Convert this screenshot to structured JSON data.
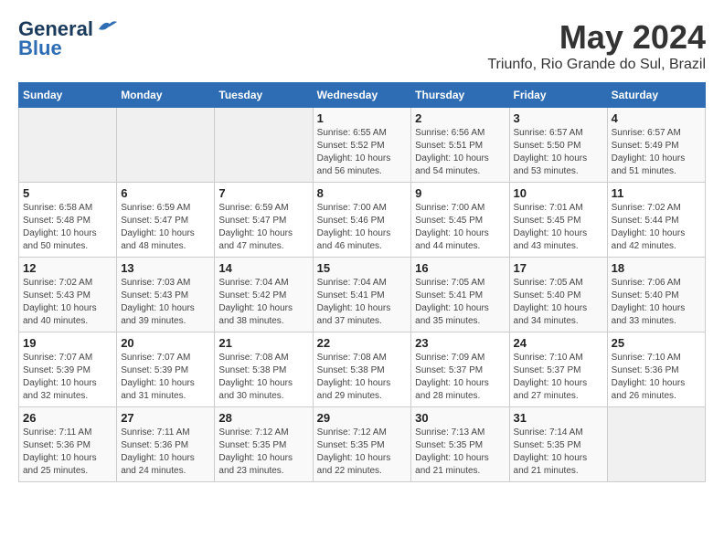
{
  "header": {
    "logo_line1": "General",
    "logo_line2": "Blue",
    "month_year": "May 2024",
    "location": "Triunfo, Rio Grande do Sul, Brazil"
  },
  "days_of_week": [
    "Sunday",
    "Monday",
    "Tuesday",
    "Wednesday",
    "Thursday",
    "Friday",
    "Saturday"
  ],
  "weeks": [
    [
      {
        "day": "",
        "sunrise": "",
        "sunset": "",
        "daylight": ""
      },
      {
        "day": "",
        "sunrise": "",
        "sunset": "",
        "daylight": ""
      },
      {
        "day": "",
        "sunrise": "",
        "sunset": "",
        "daylight": ""
      },
      {
        "day": "1",
        "sunrise": "Sunrise: 6:55 AM",
        "sunset": "Sunset: 5:52 PM",
        "daylight": "Daylight: 10 hours and 56 minutes."
      },
      {
        "day": "2",
        "sunrise": "Sunrise: 6:56 AM",
        "sunset": "Sunset: 5:51 PM",
        "daylight": "Daylight: 10 hours and 54 minutes."
      },
      {
        "day": "3",
        "sunrise": "Sunrise: 6:57 AM",
        "sunset": "Sunset: 5:50 PM",
        "daylight": "Daylight: 10 hours and 53 minutes."
      },
      {
        "day": "4",
        "sunrise": "Sunrise: 6:57 AM",
        "sunset": "Sunset: 5:49 PM",
        "daylight": "Daylight: 10 hours and 51 minutes."
      }
    ],
    [
      {
        "day": "5",
        "sunrise": "Sunrise: 6:58 AM",
        "sunset": "Sunset: 5:48 PM",
        "daylight": "Daylight: 10 hours and 50 minutes."
      },
      {
        "day": "6",
        "sunrise": "Sunrise: 6:59 AM",
        "sunset": "Sunset: 5:47 PM",
        "daylight": "Daylight: 10 hours and 48 minutes."
      },
      {
        "day": "7",
        "sunrise": "Sunrise: 6:59 AM",
        "sunset": "Sunset: 5:47 PM",
        "daylight": "Daylight: 10 hours and 47 minutes."
      },
      {
        "day": "8",
        "sunrise": "Sunrise: 7:00 AM",
        "sunset": "Sunset: 5:46 PM",
        "daylight": "Daylight: 10 hours and 46 minutes."
      },
      {
        "day": "9",
        "sunrise": "Sunrise: 7:00 AM",
        "sunset": "Sunset: 5:45 PM",
        "daylight": "Daylight: 10 hours and 44 minutes."
      },
      {
        "day": "10",
        "sunrise": "Sunrise: 7:01 AM",
        "sunset": "Sunset: 5:45 PM",
        "daylight": "Daylight: 10 hours and 43 minutes."
      },
      {
        "day": "11",
        "sunrise": "Sunrise: 7:02 AM",
        "sunset": "Sunset: 5:44 PM",
        "daylight": "Daylight: 10 hours and 42 minutes."
      }
    ],
    [
      {
        "day": "12",
        "sunrise": "Sunrise: 7:02 AM",
        "sunset": "Sunset: 5:43 PM",
        "daylight": "Daylight: 10 hours and 40 minutes."
      },
      {
        "day": "13",
        "sunrise": "Sunrise: 7:03 AM",
        "sunset": "Sunset: 5:43 PM",
        "daylight": "Daylight: 10 hours and 39 minutes."
      },
      {
        "day": "14",
        "sunrise": "Sunrise: 7:04 AM",
        "sunset": "Sunset: 5:42 PM",
        "daylight": "Daylight: 10 hours and 38 minutes."
      },
      {
        "day": "15",
        "sunrise": "Sunrise: 7:04 AM",
        "sunset": "Sunset: 5:41 PM",
        "daylight": "Daylight: 10 hours and 37 minutes."
      },
      {
        "day": "16",
        "sunrise": "Sunrise: 7:05 AM",
        "sunset": "Sunset: 5:41 PM",
        "daylight": "Daylight: 10 hours and 35 minutes."
      },
      {
        "day": "17",
        "sunrise": "Sunrise: 7:05 AM",
        "sunset": "Sunset: 5:40 PM",
        "daylight": "Daylight: 10 hours and 34 minutes."
      },
      {
        "day": "18",
        "sunrise": "Sunrise: 7:06 AM",
        "sunset": "Sunset: 5:40 PM",
        "daylight": "Daylight: 10 hours and 33 minutes."
      }
    ],
    [
      {
        "day": "19",
        "sunrise": "Sunrise: 7:07 AM",
        "sunset": "Sunset: 5:39 PM",
        "daylight": "Daylight: 10 hours and 32 minutes."
      },
      {
        "day": "20",
        "sunrise": "Sunrise: 7:07 AM",
        "sunset": "Sunset: 5:39 PM",
        "daylight": "Daylight: 10 hours and 31 minutes."
      },
      {
        "day": "21",
        "sunrise": "Sunrise: 7:08 AM",
        "sunset": "Sunset: 5:38 PM",
        "daylight": "Daylight: 10 hours and 30 minutes."
      },
      {
        "day": "22",
        "sunrise": "Sunrise: 7:08 AM",
        "sunset": "Sunset: 5:38 PM",
        "daylight": "Daylight: 10 hours and 29 minutes."
      },
      {
        "day": "23",
        "sunrise": "Sunrise: 7:09 AM",
        "sunset": "Sunset: 5:37 PM",
        "daylight": "Daylight: 10 hours and 28 minutes."
      },
      {
        "day": "24",
        "sunrise": "Sunrise: 7:10 AM",
        "sunset": "Sunset: 5:37 PM",
        "daylight": "Daylight: 10 hours and 27 minutes."
      },
      {
        "day": "25",
        "sunrise": "Sunrise: 7:10 AM",
        "sunset": "Sunset: 5:36 PM",
        "daylight": "Daylight: 10 hours and 26 minutes."
      }
    ],
    [
      {
        "day": "26",
        "sunrise": "Sunrise: 7:11 AM",
        "sunset": "Sunset: 5:36 PM",
        "daylight": "Daylight: 10 hours and 25 minutes."
      },
      {
        "day": "27",
        "sunrise": "Sunrise: 7:11 AM",
        "sunset": "Sunset: 5:36 PM",
        "daylight": "Daylight: 10 hours and 24 minutes."
      },
      {
        "day": "28",
        "sunrise": "Sunrise: 7:12 AM",
        "sunset": "Sunset: 5:35 PM",
        "daylight": "Daylight: 10 hours and 23 minutes."
      },
      {
        "day": "29",
        "sunrise": "Sunrise: 7:12 AM",
        "sunset": "Sunset: 5:35 PM",
        "daylight": "Daylight: 10 hours and 22 minutes."
      },
      {
        "day": "30",
        "sunrise": "Sunrise: 7:13 AM",
        "sunset": "Sunset: 5:35 PM",
        "daylight": "Daylight: 10 hours and 21 minutes."
      },
      {
        "day": "31",
        "sunrise": "Sunrise: 7:14 AM",
        "sunset": "Sunset: 5:35 PM",
        "daylight": "Daylight: 10 hours and 21 minutes."
      },
      {
        "day": "",
        "sunrise": "",
        "sunset": "",
        "daylight": ""
      }
    ]
  ]
}
